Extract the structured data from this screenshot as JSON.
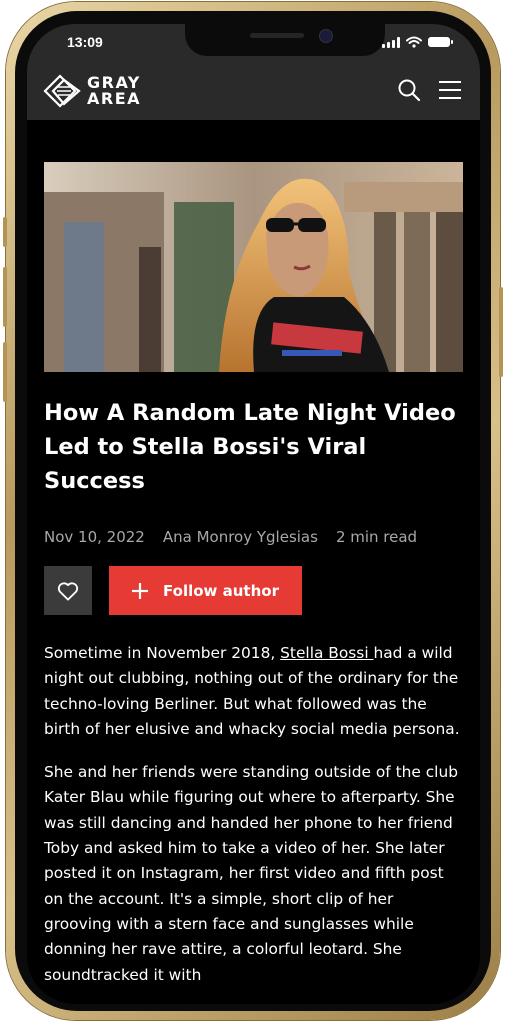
{
  "status_bar": {
    "time": "13:09"
  },
  "header": {
    "logo_line1": "GRAY",
    "logo_line2": "AREA"
  },
  "article": {
    "title": "How A Random Late Night Video Led to Stella Bossi's Viral Success",
    "date": "Nov 10, 2022",
    "author": "Ana Monroy Yglesias",
    "read_time": "2 min read",
    "follow_label": "Follow author",
    "p1_before": "Sometime in November 2018, ",
    "p1_link": "Stella Bossi ",
    "p1_after": "had a wild night out clubbing, nothing out of the ordinary for the techno-loving Berliner. But what followed was the birth of her elusive and whacky social media persona.",
    "p2": "She and her friends were standing outside of the club Kater Blau while figuring out where to afterparty. She was still dancing and handed her phone to her friend Toby and asked him to take a video of her. She later posted it on Instagram, her first video and fifth post on the account. It's a simple, short clip of her grooving with a stern face and sunglasses while donning her rave attire, a colorful leotard. She soundtracked it with"
  },
  "colors": {
    "accent": "#e63b34",
    "header_bg": "#2a2a2a",
    "page_bg": "#000000",
    "phone_frame": "#c9ad72"
  },
  "icons": [
    "logo-diamond-icon",
    "search-icon",
    "menu-icon",
    "heart-icon",
    "plus-icon",
    "signal-icon",
    "wifi-icon",
    "battery-icon"
  ]
}
